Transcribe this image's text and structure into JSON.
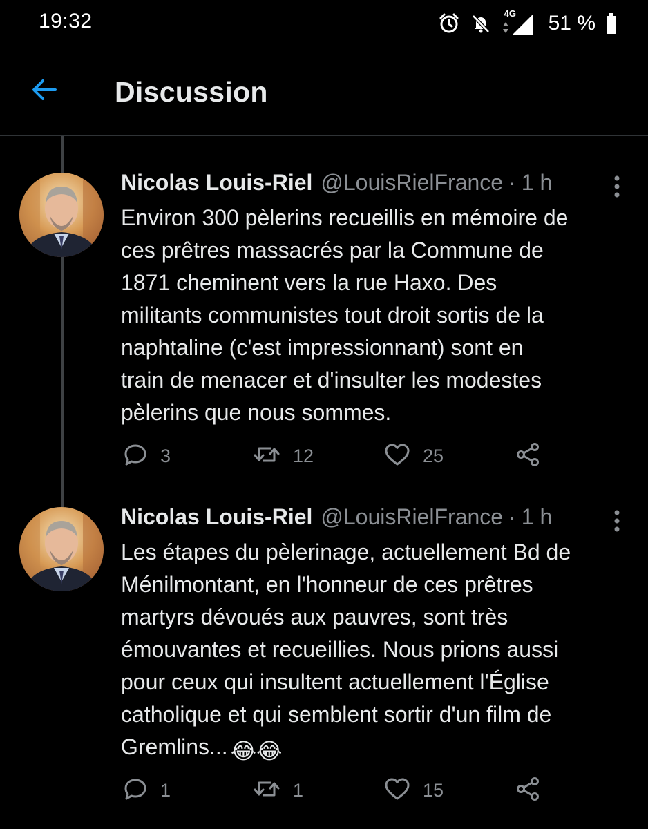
{
  "status_bar": {
    "time": "19:32",
    "network": "4G",
    "battery": "51 %",
    "icons": [
      "alarm-icon",
      "bell-muted-icon",
      "signal-icon",
      "battery-icon"
    ]
  },
  "header": {
    "title": "Discussion",
    "back_icon": "arrow-left-icon",
    "accent_color": "#1d9bf0"
  },
  "tweets": [
    {
      "author": "Nicolas Louis-Riel",
      "handle": "@LouisRielFrance",
      "separator": "·",
      "time": "1 h",
      "text": "Environ 300 pèlerins recueillis en mémoire de\nces prêtres massacrés par la Commune de\n1871 cheminent vers la rue Haxo. Des\nmilitants communistes tout droit sortis de la\nnaphtaline (c'est impressionnant) sont en\ntrain de menacer et d'insulter les modestes\npèlerins que nous sommes.",
      "emoji": "",
      "replies": "3",
      "retweets": "12",
      "likes": "25"
    },
    {
      "author": "Nicolas Louis-Riel",
      "handle": "@LouisRielFrance",
      "separator": "·",
      "time": "1 h",
      "text": "Les étapes du pèlerinage, actuellement Bd de\nMénilmontant, en l'honneur de ces prêtres\nmartyrs dévoués aux pauvres, sont très\némouvantes et recueillies. Nous prions aussi\npour ceux qui insultent actuellement l'Église\ncatholique et qui semblent sortir d'un film de\nGremlins...",
      "emoji": "😂😂",
      "replies": "1",
      "retweets": "1",
      "likes": "15"
    }
  ],
  "colors": {
    "background": "#000000",
    "text_primary": "#e7e9ea",
    "text_secondary": "#8b8f94",
    "divider": "#2f3336"
  }
}
